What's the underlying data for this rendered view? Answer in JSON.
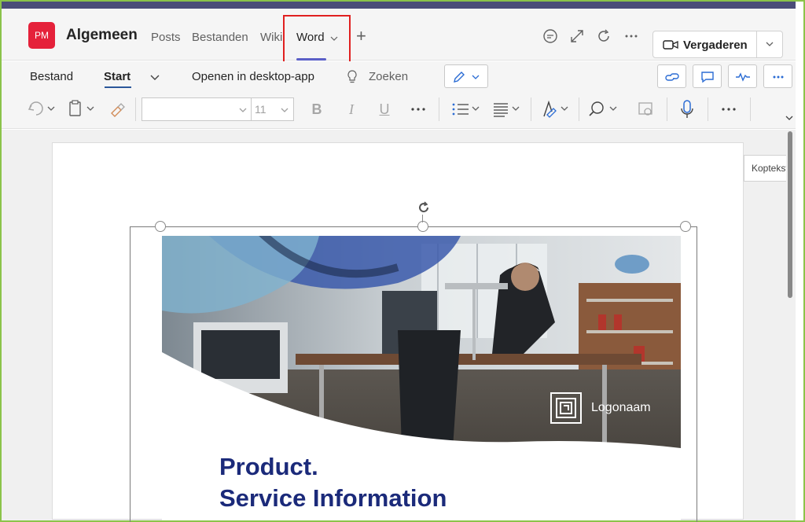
{
  "header": {
    "avatar_initials": "PM",
    "channel_name": "Algemeen",
    "tabs": [
      {
        "label": "Posts"
      },
      {
        "label": "Bestanden"
      },
      {
        "label": "Wiki"
      },
      {
        "label": "Word"
      }
    ],
    "meeting_button": "Vergaderen"
  },
  "ribbon": {
    "tabs": [
      "Bestand",
      "Start"
    ],
    "open_desktop": "Openen in desktop-app",
    "search": "Zoeken",
    "font_size": "11"
  },
  "document": {
    "header_tooltip": "Koptekst",
    "logo_name": "Logonaam",
    "title_line1": "Product.",
    "title_line2": "Service Information"
  },
  "colors": {
    "accent": "#5b5fc7",
    "avatar": "#e5213a",
    "title": "#1b2a7a",
    "highlight": "#e02020",
    "frame": "#8bc34a"
  }
}
